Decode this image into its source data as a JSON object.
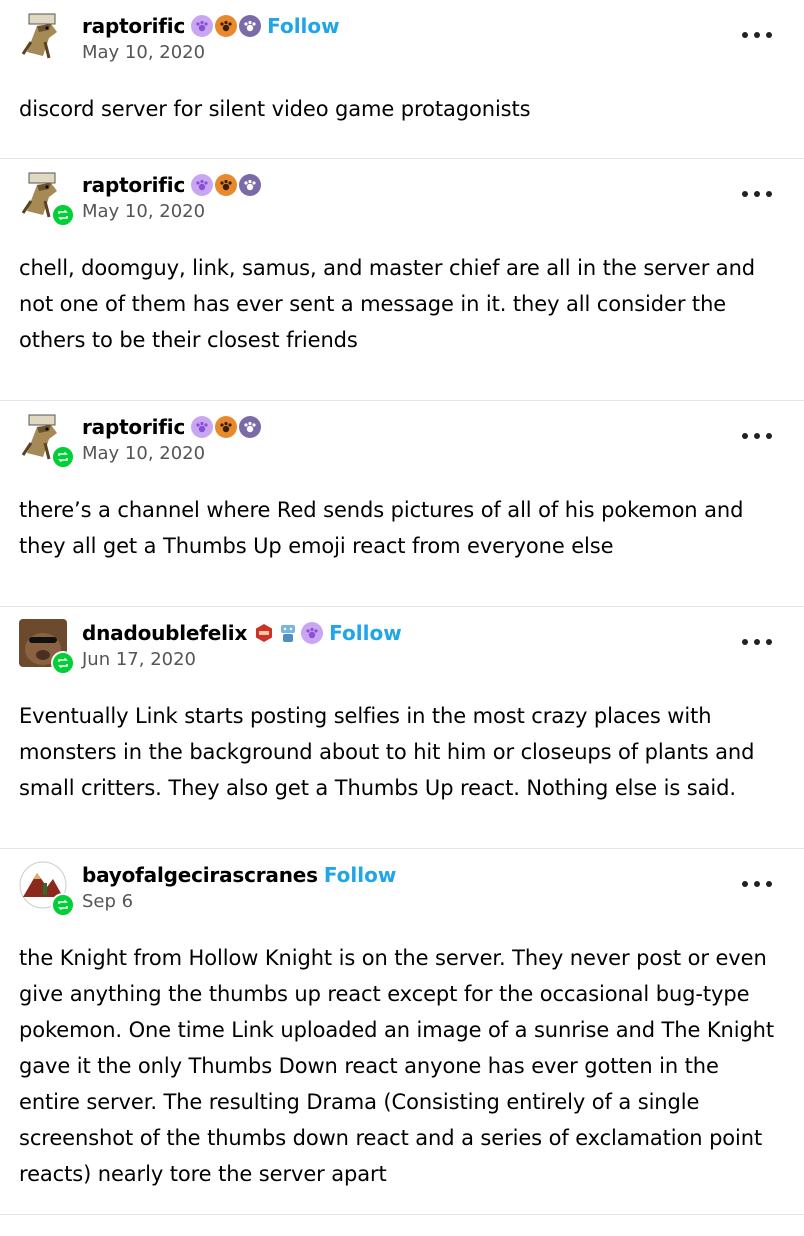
{
  "posts": [
    {
      "username": "raptorific",
      "follow": "Follow",
      "date": "May 10, 2020",
      "text": "discord server for silent video game protagonists"
    },
    {
      "username": "raptorific",
      "date": "May 10, 2020",
      "text": "chell, doomguy, link, samus, and master chief are all in the server and not one of them has ever sent a message in it. they all consider the others to be their closest friends"
    },
    {
      "username": "raptorific",
      "date": "May 10, 2020",
      "text": "there’s a channel where Red sends pictures of all of his pokemon and they all get a Thumbs Up emoji react from everyone else"
    },
    {
      "username": "dnadoublefelix",
      "follow": "Follow",
      "date": "Jun 17, 2020",
      "text": "Eventually Link starts posting selfies in the most crazy places with monsters in the background about to hit him or closeups of plants and small critters. They also get a Thumbs Up react. Nothing else is said."
    },
    {
      "username": "bayofalgecirascranes",
      "follow": "Follow",
      "date": "Sep 6",
      "text": "the Knight from Hollow Knight is on the server. They never post or even give anything the thumbs up react except for the occasional bug-type pokemon. One time Link uploaded an image of a sunrise and The Knight gave it the only Thumbs Down react anyone has ever gotten in the entire server. The resulting Drama (Consisting entirely of a single screenshot of the thumbs down react and a series of exclamation point reacts) nearly tore the server apart"
    }
  ],
  "colors": {
    "follow": "#1fa5e8",
    "reblog_badge": "#00cf35",
    "date": "#555555",
    "divider": "#e6e6e6"
  },
  "icons": {
    "more": "more-options-icon",
    "reblog": "reblog-icon"
  }
}
